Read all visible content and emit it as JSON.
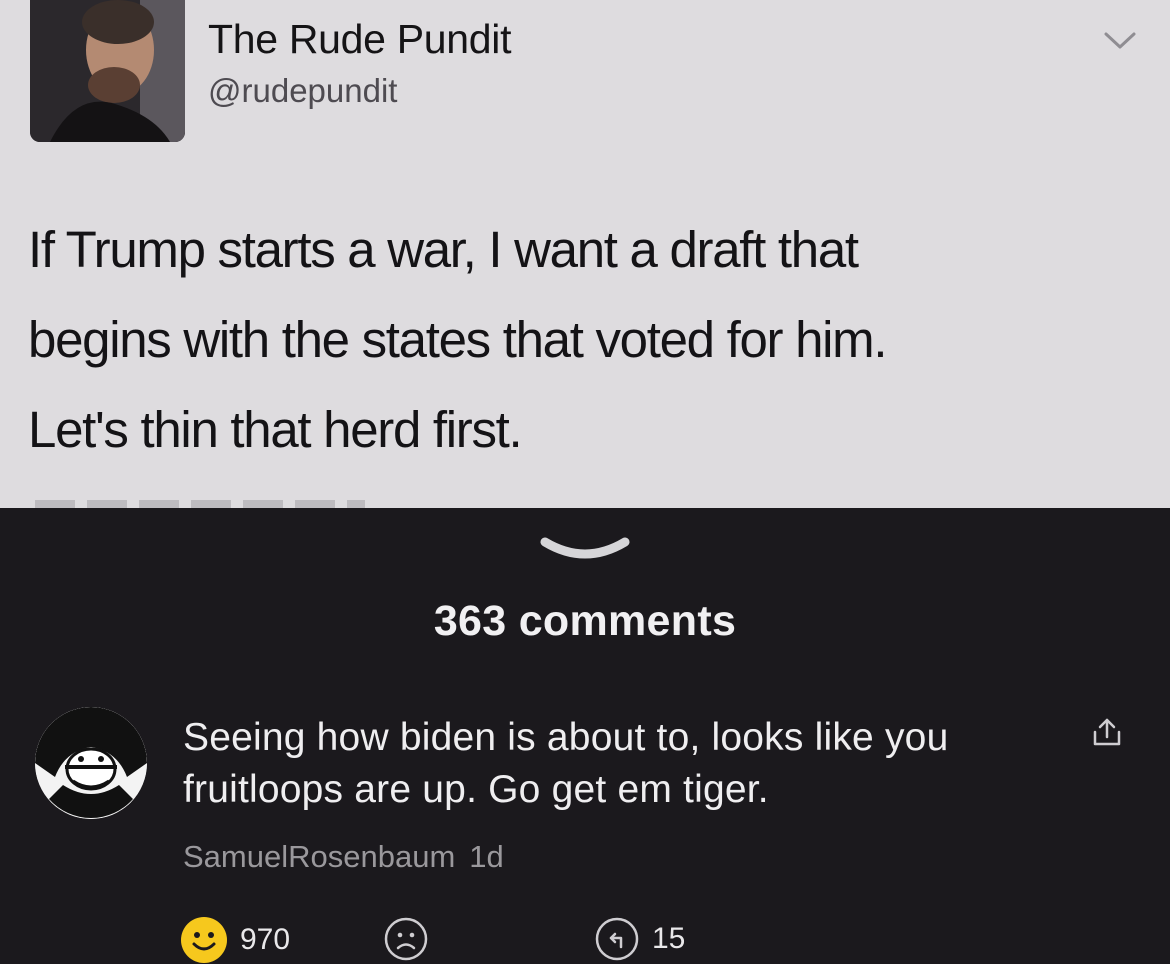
{
  "tweet": {
    "display_name": "The Rude Pundit",
    "handle": "@rudepundit",
    "text": "If Trump starts a war, I want a draft that\nbegins with the states that voted for him.\nLet's thin that herd first.",
    "avatar_icon": "user-photo-avatar",
    "menu_icon": "chevron-down-icon"
  },
  "thread": {
    "comments_count_label": "363 comments",
    "collapse_icon": "chevron-down-icon"
  },
  "comment": {
    "text": "Seeing how biden is about to, looks like you fruitloops are up. Go get em tiger.",
    "author": "SamuelRosenbaum",
    "time": "1d",
    "likes": "970",
    "replies": "15",
    "like_icon": "smiley-face-icon",
    "dislike_icon": "sad-face-icon",
    "reply_icon": "reply-arrow-icon",
    "share_icon": "share-icon"
  },
  "colors": {
    "tweet_background": "#dedcdf",
    "dark_background": "#1b191d",
    "like_yellow": "#f6c81d"
  }
}
